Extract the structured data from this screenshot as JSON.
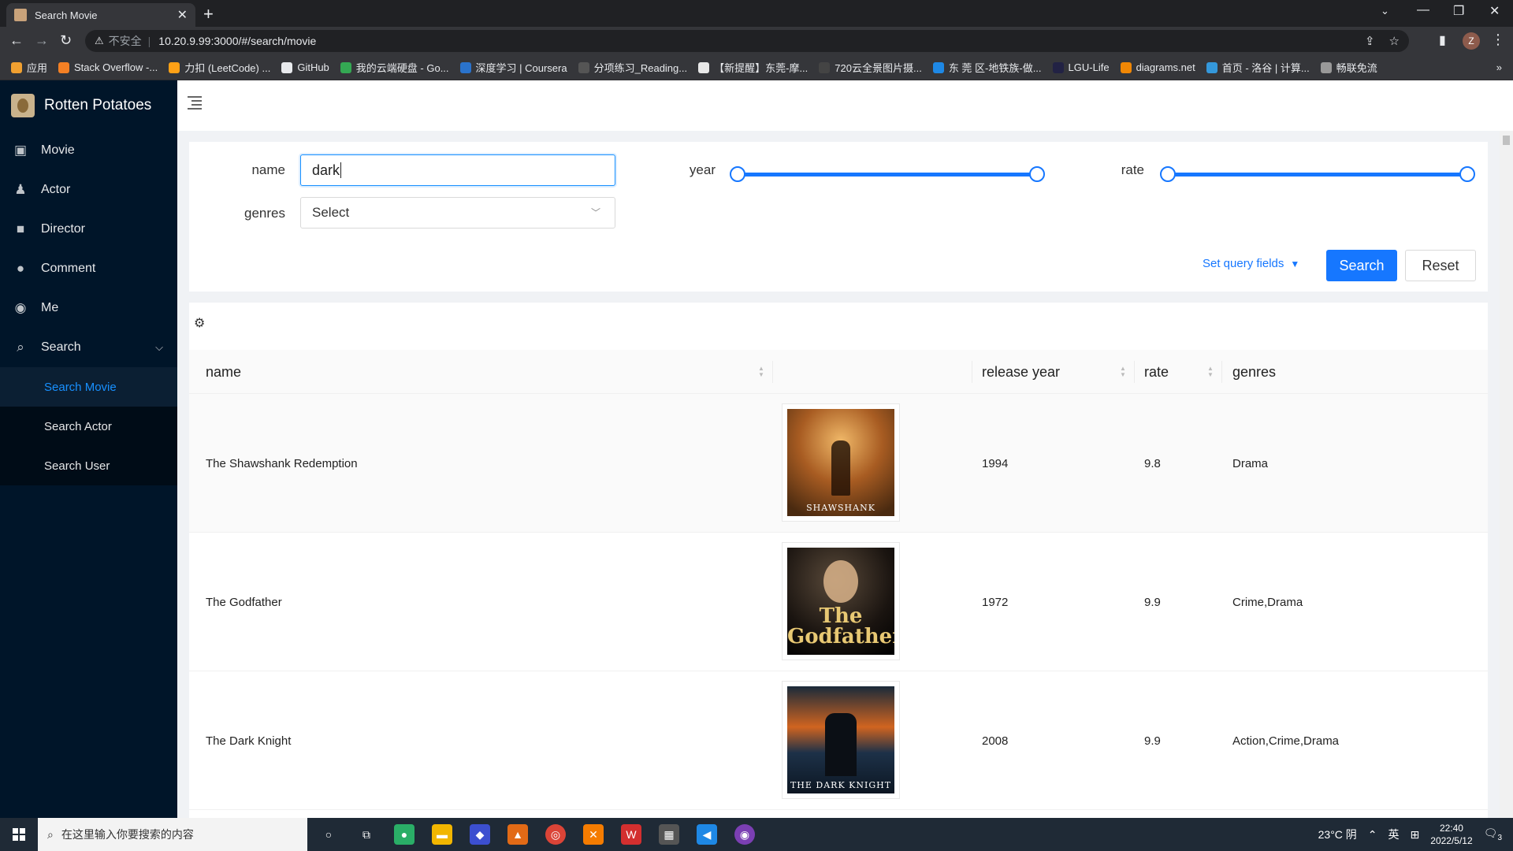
{
  "browser": {
    "tab_title": "Search Movie",
    "address_insecure": "不安全",
    "address_url": "10.20.9.99:3000/#/search/movie",
    "profile_initial": "Z",
    "bookmarks": [
      {
        "label": "应用",
        "color": "#f0a030"
      },
      {
        "label": "Stack Overflow -...",
        "color": "#f48024"
      },
      {
        "label": "力扣 (LeetCode) ...",
        "color": "#ffa116"
      },
      {
        "label": "GitHub",
        "color": "#e8eaed"
      },
      {
        "label": "我的云端硬盘 - Go...",
        "color": "#34a853"
      },
      {
        "label": "深度学习 | Coursera",
        "color": "#2a73cc"
      },
      {
        "label": "分项练习_Reading...",
        "color": "#555555"
      },
      {
        "label": "【新提醒】东莞-摩...",
        "color": "#e8e8e8"
      },
      {
        "label": "720云全景图片摄...",
        "color": "#444444"
      },
      {
        "label": "东 莞 区-地铁族-做...",
        "color": "#1e88e5"
      },
      {
        "label": "LGU-Life",
        "color": "#222244"
      },
      {
        "label": "diagrams.net",
        "color": "#f08705"
      },
      {
        "label": "首页 - 洛谷 | 计算...",
        "color": "#3498db"
      },
      {
        "label": "畅联免流",
        "color": "#999999"
      }
    ]
  },
  "app": {
    "logo_text": "Rotten Potatoes",
    "menu": [
      {
        "label": "Movie",
        "icon": "video-icon"
      },
      {
        "label": "Actor",
        "icon": "person-icon"
      },
      {
        "label": "Director",
        "icon": "camera-icon"
      },
      {
        "label": "Comment",
        "icon": "comment-icon"
      },
      {
        "label": "Me",
        "icon": "user-circle-icon"
      },
      {
        "label": "Search",
        "icon": "search-icon"
      }
    ],
    "submenu": [
      {
        "label": "Search Movie",
        "active": true
      },
      {
        "label": "Search Actor",
        "active": false
      },
      {
        "label": "Search User",
        "active": false
      }
    ]
  },
  "form": {
    "name_label": "name",
    "name_value": "dark",
    "genres_label": "genres",
    "genres_value": "Select",
    "year_label": "year",
    "rate_label": "rate",
    "year_range_fraction": [
      0.0,
      1.0
    ],
    "rate_range_fraction": [
      0.0,
      1.0
    ],
    "query_fields_label": "Set query fields",
    "search_label": "Search",
    "reset_label": "Reset"
  },
  "table": {
    "columns": [
      "name",
      "",
      "release year",
      "rate",
      "genres"
    ],
    "rows": [
      {
        "name": "The Shawshank Redemption",
        "year": "1994",
        "rate": "9.8",
        "genres": "Drama",
        "poster_caption": "SHAWSHANK"
      },
      {
        "name": "The Godfather",
        "year": "1972",
        "rate": "9.9",
        "genres": "Crime,Drama",
        "poster_caption": "The Godfather"
      },
      {
        "name": "The Dark Knight",
        "year": "2008",
        "rate": "9.9",
        "genres": "Action,Crime,Drama",
        "poster_caption": "THE DARK KNIGHT"
      }
    ]
  },
  "taskbar": {
    "search_placeholder": "在这里输入你要搜索的内容",
    "weather": "23°C 阴",
    "ime": "英",
    "time": "22:40",
    "date": "2022/5/12",
    "notifications": "3"
  }
}
